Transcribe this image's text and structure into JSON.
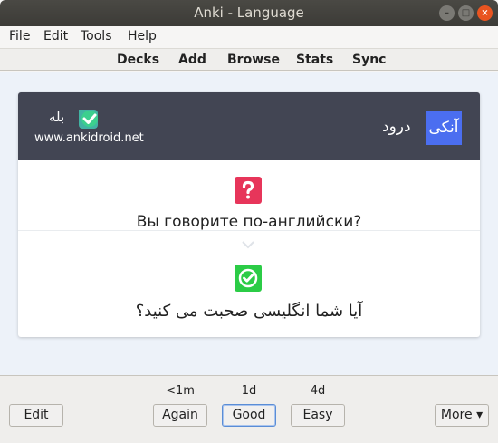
{
  "window": {
    "title": "Anki - Language"
  },
  "menu": {
    "file": "File",
    "edit": "Edit",
    "tools": "Tools",
    "help": "Help"
  },
  "toolbar": {
    "decks": "Decks",
    "add": "Add",
    "browse": "Browse",
    "stats": "Stats",
    "sync": "Sync"
  },
  "card": {
    "header": {
      "yes": "بله",
      "url": "www.ankidroid.net",
      "hello": "درود",
      "anki": "آنکی"
    },
    "question": "Вы говорите по-английски?",
    "answer": "آیا شما انگلیسی صحبت می کنید؟"
  },
  "answer_bar": {
    "again_interval": "<1m",
    "good_interval": "1d",
    "easy_interval": "4d",
    "edit_label": "Edit",
    "again_label": "Again",
    "good_label": "Good",
    "easy_label": "Easy",
    "more_label": "More ▾"
  },
  "colors": {
    "header_bg": "#424553",
    "anki_badge": "#4b6ef0",
    "question_icon": "#e7355a",
    "answer_icon": "#2bcc46"
  },
  "icons": {
    "question": "question-mark-icon",
    "answer": "check-icon",
    "logo": "ankidroid-check-logo"
  }
}
